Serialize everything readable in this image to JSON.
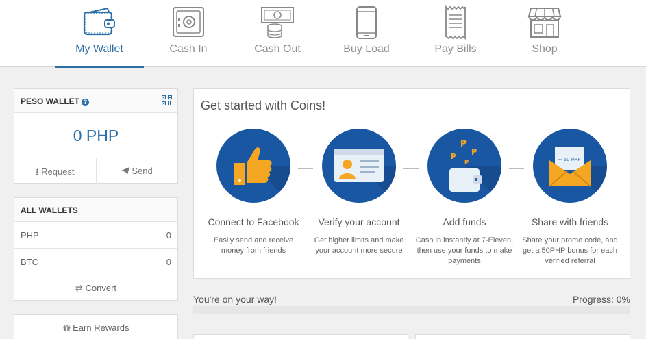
{
  "nav": {
    "tabs": [
      {
        "label": "My Wallet",
        "icon": "wallet-icon",
        "active": true
      },
      {
        "label": "Cash In",
        "icon": "safe-icon",
        "active": false
      },
      {
        "label": "Cash Out",
        "icon": "cash-coins-icon",
        "active": false
      },
      {
        "label": "Buy Load",
        "icon": "phone-icon",
        "active": false
      },
      {
        "label": "Pay Bills",
        "icon": "receipt-icon",
        "active": false
      },
      {
        "label": "Shop",
        "icon": "store-icon",
        "active": false
      }
    ]
  },
  "peso_wallet": {
    "title": "PESO WALLET",
    "balance": "0 PHP",
    "request_label": "Request",
    "send_label": "Send"
  },
  "all_wallets": {
    "title": "ALL WALLETS",
    "rows": [
      {
        "currency": "PHP",
        "amount": "0"
      },
      {
        "currency": "BTC",
        "amount": "0"
      }
    ],
    "convert_label": "Convert"
  },
  "rewards": {
    "label": "Earn Rewards"
  },
  "get_started": {
    "title": "Get started with Coins!",
    "steps": [
      {
        "title": "Connect to Facebook",
        "desc": "Easily send and receive money from friends",
        "icon": "thumbs-up-icon"
      },
      {
        "title": "Verify your account",
        "desc": "Get higher limits and make your account more secure",
        "icon": "id-card-icon"
      },
      {
        "title": "Add funds",
        "desc": "Cash in instantly at 7-Eleven, then use your funds to make payments",
        "icon": "wallet-coins-icon"
      },
      {
        "title": "Share with friends",
        "desc": "Share your promo code, and get a 50PHP bonus for each verified referral",
        "icon": "envelope-icon",
        "badge": "+ 50 PHP"
      }
    ]
  },
  "progress": {
    "message": "You're on your way!",
    "label": "Progress: 0%",
    "value": 0
  },
  "colors": {
    "accent": "#2c6fa8",
    "circle": "#1a57a3",
    "icon_orange": "#f5a623"
  }
}
